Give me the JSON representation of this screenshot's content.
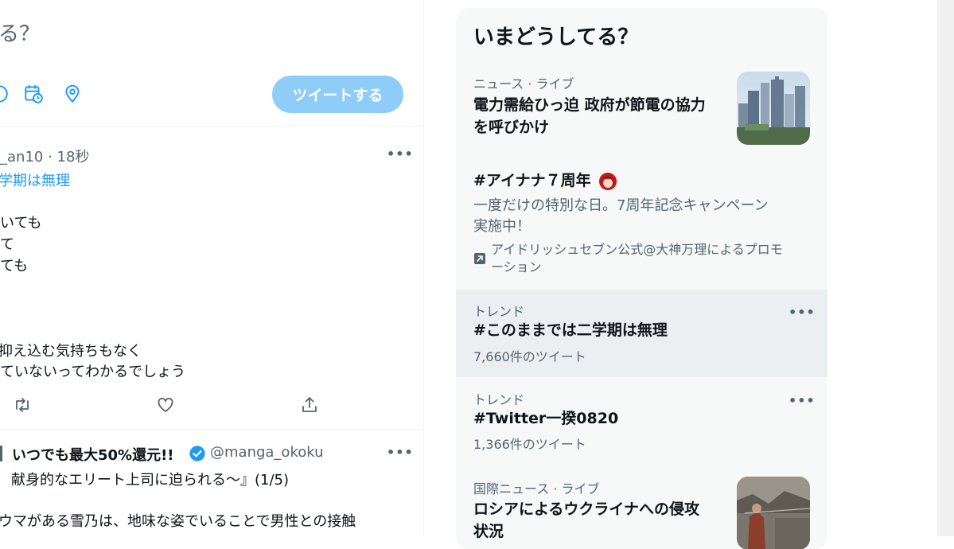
{
  "compose": {
    "prompt": "る？",
    "tweet_button": "ツイートする"
  },
  "tweets": [
    {
      "handle_time": "_an10 · 18秒",
      "hashtag": "学期は無理",
      "lines": [
        "いても",
        "て",
        "ても",
        "",
        "",
        "抑え込む気持ちもなく",
        "ていないってわかるでしょう"
      ]
    },
    {
      "name": "いつでも最大50%還元!!",
      "handle": "@manga_okoku",
      "subtitle": "献身的なエリート上司に迫られる～』(1/5)",
      "body": "ウマがある雪乃は、地味な姿でいることで男性との接触"
    }
  ],
  "trends_panel": {
    "title": "いまどうしてる？",
    "items": [
      {
        "meta": "ニュース · ライブ",
        "headline_lines": [
          "電力需給ひっ迫 政府が節電の協力",
          "を呼びかけ"
        ]
      },
      {
        "headline": "#アイナナ７周年",
        "body_lines": [
          "一度だけの特別な日。7周年記念キャンペーン",
          "実施中！"
        ],
        "promo_lines": [
          "アイドリッシュセブン公式@大神万理によるプロモ",
          "ーション"
        ]
      },
      {
        "meta": "トレンド",
        "headline": "#このままでは二学期は無理",
        "count": "7,660件のツイート"
      },
      {
        "meta": "トレンド",
        "headline": "#Twitter一揆0820",
        "count": "1,366件のツイート"
      },
      {
        "meta": "国際ニュース · ライブ",
        "headline_lines": [
          "ロシアによるウクライナへの侵攻",
          "状況"
        ]
      }
    ]
  },
  "colors": {
    "accent": "#1d9bf0",
    "tweet_button_disabled": "#8ecdf7",
    "secondary_text": "#536471",
    "panel_bg": "#f7f9f9"
  }
}
